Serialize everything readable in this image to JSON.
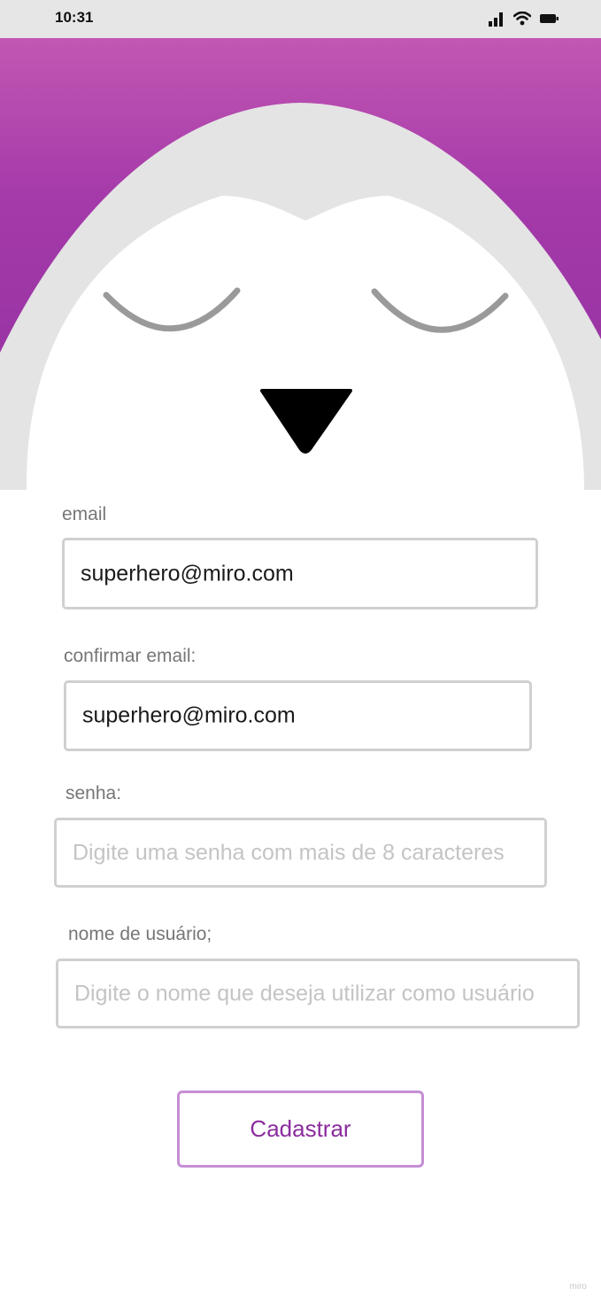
{
  "status_bar": {
    "time": "10:31",
    "icons": [
      "signal-icon",
      "wifi-icon",
      "battery-icon"
    ]
  },
  "hero": {
    "top_color": "#c257b3",
    "mid_color": "#9b35a5",
    "face_color": "#e4e4e4",
    "beak_color": "#000000"
  },
  "form": {
    "email": {
      "label": "email",
      "value": "superhero@miro.com"
    },
    "confirm_email": {
      "label": "confirmar email:",
      "value": "superhero@miro.com"
    },
    "password": {
      "label": "senha:",
      "placeholder": "Digite uma senha com mais de 8 caracteres"
    },
    "username": {
      "label": "nome de usuário;",
      "placeholder": "Digite o nome que deseja utilizar como usuário"
    },
    "submit_label": "Cadastrar",
    "accent_color": "#8b2c9e"
  },
  "watermark": "miro"
}
